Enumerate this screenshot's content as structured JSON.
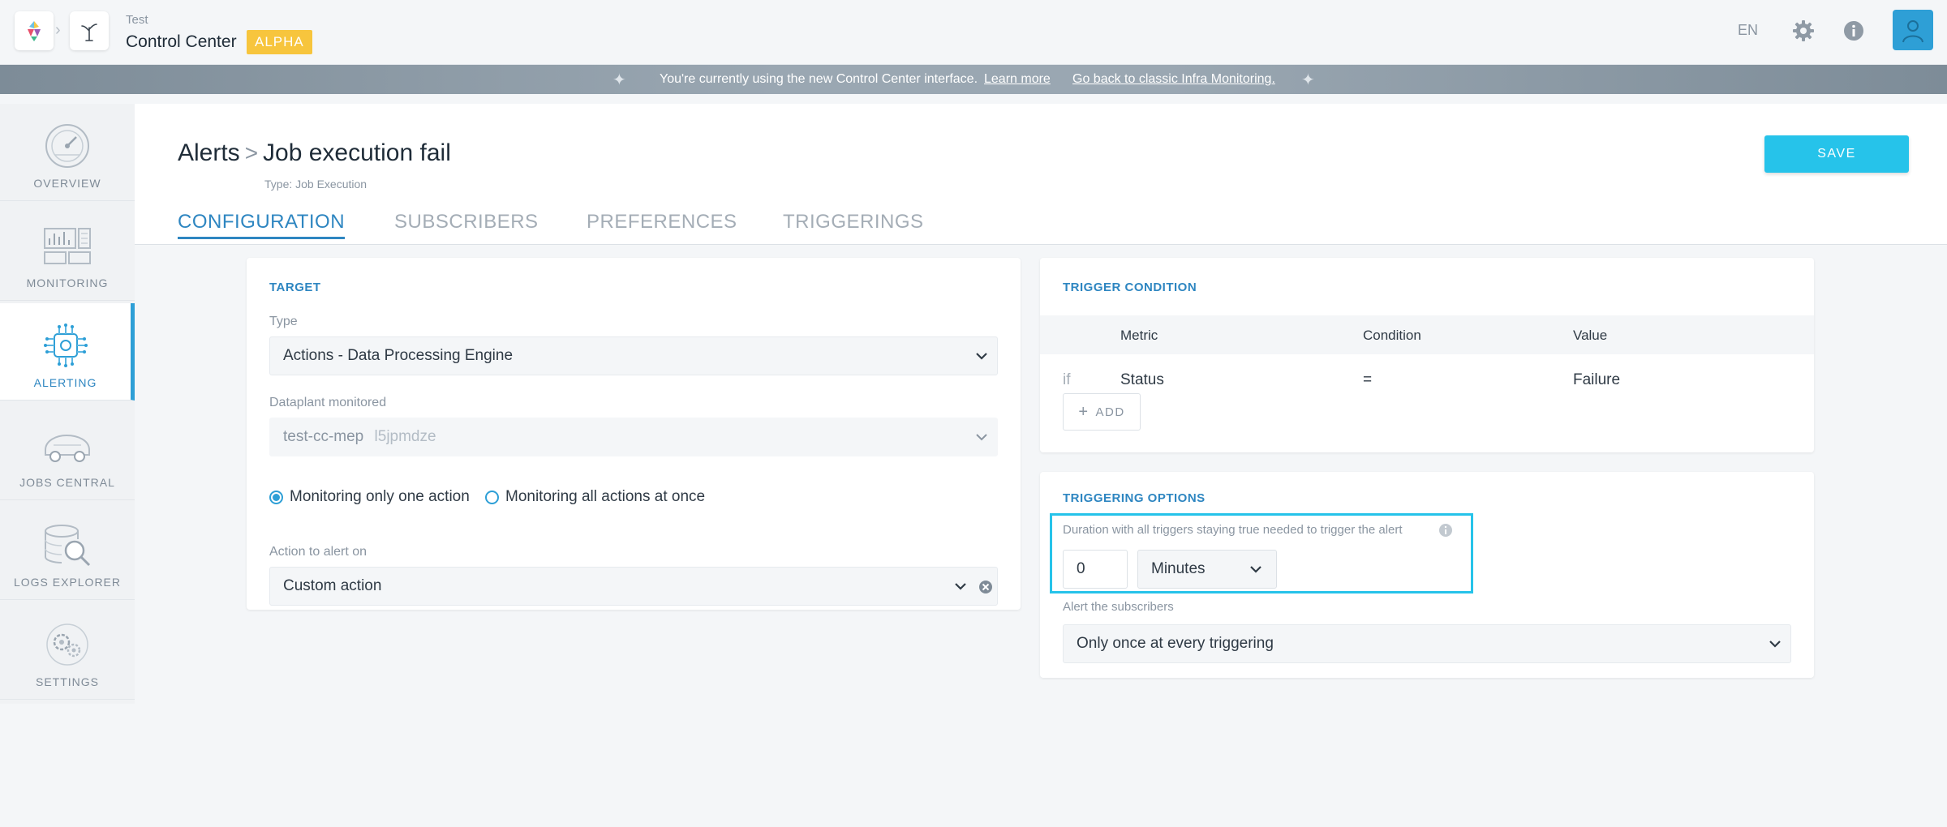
{
  "header": {
    "project_name": "Test",
    "app_name": "Control Center",
    "badge": "ALPHA",
    "language": "EN"
  },
  "banner": {
    "message": "You're currently using the new Control Center interface.",
    "learn_more": "Learn more",
    "go_back": "Go back to classic Infra Monitoring."
  },
  "sidebar": {
    "items": [
      {
        "label": "OVERVIEW",
        "icon": "gauge-icon"
      },
      {
        "label": "MONITORING",
        "icon": "monitoring-dashboard-icon"
      },
      {
        "label": "ALERTING",
        "icon": "alerting-chip-icon",
        "active": true
      },
      {
        "label": "JOBS CENTRAL",
        "icon": "jobs-truck-icon"
      },
      {
        "label": "LOGS EXPLORER",
        "icon": "logs-search-icon"
      },
      {
        "label": "SETTINGS",
        "icon": "settings-gears-icon"
      }
    ]
  },
  "page": {
    "breadcrumb_root": "Alerts",
    "breadcrumb_sep": ">",
    "title": "Job execution fail",
    "subtype": "Type: Job Execution",
    "save_label": "SAVE",
    "tabs": [
      {
        "label": "CONFIGURATION",
        "active": true
      },
      {
        "label": "SUBSCRIBERS"
      },
      {
        "label": "PREFERENCES"
      },
      {
        "label": "TRIGGERINGS"
      }
    ]
  },
  "target": {
    "title": "TARGET",
    "type_label": "Type",
    "type_value": "Actions - Data Processing Engine",
    "dataplant_label": "Dataplant monitored",
    "dataplant_value": "test-cc-mep",
    "dataplant_id": "l5jpmdze",
    "radio_one": "Monitoring only one action",
    "radio_all": "Monitoring all actions at once",
    "action_label": "Action to alert on",
    "action_value": "Custom action"
  },
  "trigger_condition": {
    "title": "TRIGGER CONDITION",
    "columns": [
      "Metric",
      "Condition",
      "Value"
    ],
    "row": {
      "prefix": "if",
      "metric": "Status",
      "condition": "=",
      "value": "Failure"
    },
    "add_label": "ADD"
  },
  "triggering_options": {
    "title": "TRIGGERING OPTIONS",
    "duration_label": "Duration with all triggers staying true needed to trigger the alert",
    "duration_value": "0",
    "duration_unit": "Minutes",
    "subscribers_label": "Alert the subscribers",
    "subscribers_value": "Only once at every triggering"
  },
  "colors": {
    "accent": "#2e86c1",
    "cta": "#26c3ea",
    "badge": "#f7c53d"
  }
}
